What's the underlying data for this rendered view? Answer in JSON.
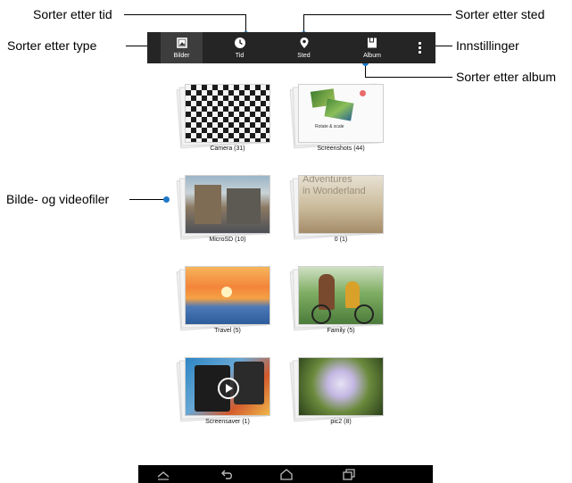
{
  "callouts": {
    "sort_by_time": "Sorter etter tid",
    "sort_by_type": "Sorter etter type",
    "sort_by_place": "Sorter etter sted",
    "settings": "Innstillinger",
    "sort_by_album": "Sorter etter album",
    "image_video_files": "Bilde- og videofiler"
  },
  "tabs": [
    {
      "label": "Bilder",
      "icon": "image-icon"
    },
    {
      "label": "Tid",
      "icon": "clock-icon"
    },
    {
      "label": "Sted",
      "icon": "location-pin-icon"
    },
    {
      "label": "Album",
      "icon": "album-icon"
    }
  ],
  "menu_icon": "overflow-menu-icon",
  "albums": [
    {
      "caption": "Camera (31)"
    },
    {
      "caption": "Screenshots (44)",
      "thumb_text": "Rotate & scale"
    },
    {
      "caption": "MicroSD (10)"
    },
    {
      "caption": "0 (1)",
      "thumb_text_1": "Adventures",
      "thumb_text_2": "in Wonderland"
    },
    {
      "caption": "Travel (5)"
    },
    {
      "caption": "Family (5)"
    },
    {
      "caption": "Screensaver (1)"
    },
    {
      "caption": "pic2 (8)"
    }
  ],
  "navbar": {
    "icons": [
      "recent-up-icon",
      "back-icon",
      "home-icon",
      "recent-apps-icon"
    ]
  },
  "colors": {
    "accent_dot": "#1f79c8",
    "tab_bar": "#252525",
    "selected_tab": "#3d3d3d"
  }
}
